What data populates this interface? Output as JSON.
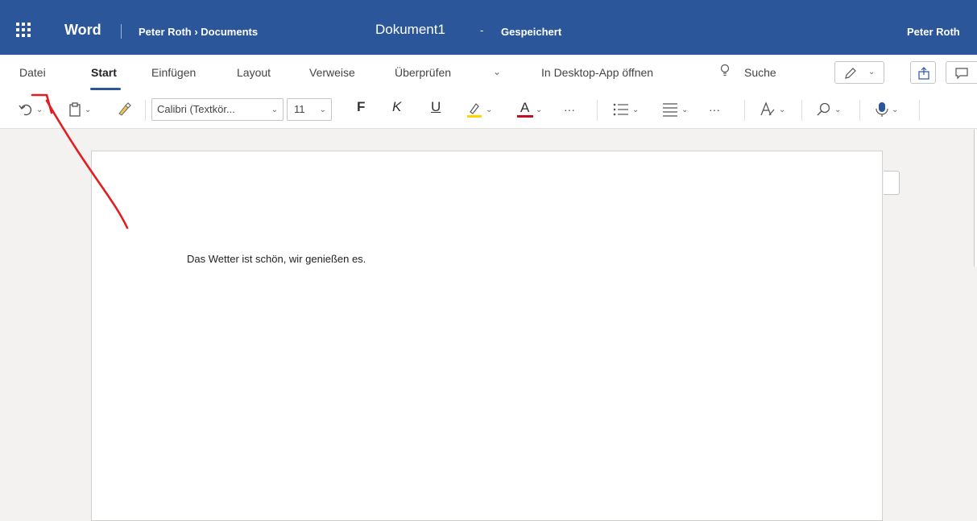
{
  "titlebar": {
    "app_name": "Word",
    "breadcrumb": "Peter Roth › Documents",
    "document_title": "Dokument1",
    "separator": "-",
    "save_status": "Gespeichert",
    "user_name": "Peter Roth"
  },
  "ribbon": {
    "tabs": [
      "Datei",
      "Start",
      "Einfügen",
      "Layout",
      "Verweise",
      "Überprüfen"
    ],
    "active_tab": "Start",
    "more_tabs_glyph": "⌄",
    "open_desktop": "In Desktop-App öffnen",
    "search_label": "Suche",
    "font_name": "Calibri (Textkör...",
    "font_size": "11",
    "bold_label": "F",
    "italic_label": "K",
    "underline_label": "U",
    "font_color_label": "A",
    "more_glyph": "···"
  },
  "document": {
    "body_text": "Das Wetter ist schön, wir genießen es."
  },
  "colors": {
    "titlebar": "#2b579a",
    "highlight": "#ffd400",
    "font_color": "#c50f1f",
    "annotation_arrow": "#e02020"
  },
  "icons": [
    "app-launcher-icon",
    "lightbulb-icon",
    "undo-icon",
    "clipboard-icon",
    "format-painter-icon",
    "highlighter-icon",
    "bullets-icon",
    "align-icon",
    "styles-icon",
    "find-icon",
    "dictate-icon",
    "pen-icon",
    "share-icon",
    "comment-icon"
  ]
}
